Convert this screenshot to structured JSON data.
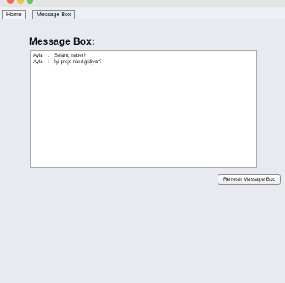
{
  "window": {
    "traffic_lights": {
      "close_color": "#ee6a5f",
      "minimize_color": "#f5be4f",
      "maximize_color": "#62c654"
    }
  },
  "tabs": [
    {
      "label": "Home",
      "selected": false
    },
    {
      "label": "Message Box",
      "selected": true
    }
  ],
  "main": {
    "title": "Message Box:",
    "messages": [
      {
        "sender": "Ayla",
        "separator": ":",
        "text": "Selam, naber?"
      },
      {
        "sender": "Ayla",
        "separator": ":",
        "text": "İyi proje nasıl gidiyor?"
      }
    ],
    "refresh_label": "Refresh Message Box"
  }
}
